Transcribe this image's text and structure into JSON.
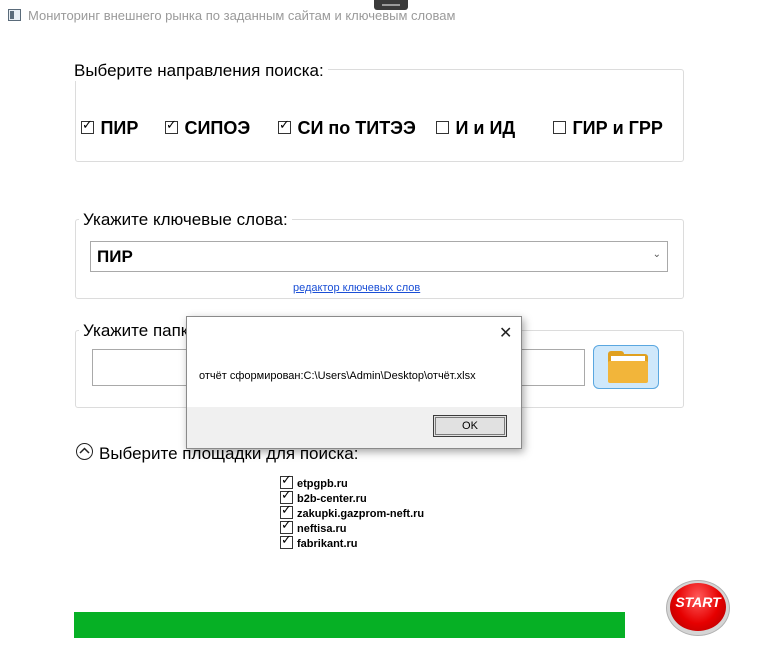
{
  "window": {
    "title": "Мониторинг внешнего рынка по заданным сайтам и ключевым словам"
  },
  "directions": {
    "label": "Выберите направления поиска:",
    "items": [
      {
        "label": "ПИР",
        "checked": true
      },
      {
        "label": "СИПОЭ",
        "checked": true
      },
      {
        "label": "СИ по ТИТЭЭ",
        "checked": true
      },
      {
        "label": "И и ИД",
        "checked": false
      },
      {
        "label": "ГИР и ГРР",
        "checked": false
      }
    ]
  },
  "keywords": {
    "label": "Укажите ключевые слова:",
    "selected": "ПИР",
    "editor_link": "редактор ключевых слов"
  },
  "path": {
    "label": "Укажите папку",
    "value": ""
  },
  "sites": {
    "label": "Выберите площадки для поиска:",
    "items": [
      {
        "label": "etpgpb.ru",
        "checked": true
      },
      {
        "label": "b2b-center.ru",
        "checked": true
      },
      {
        "label": "zakupki.gazprom-neft.ru",
        "checked": true
      },
      {
        "label": "neftisa.ru",
        "checked": true
      },
      {
        "label": "fabrikant.ru",
        "checked": true
      }
    ]
  },
  "progress": {
    "value": 1.0,
    "color": "#06b025"
  },
  "start_button": {
    "label": "START"
  },
  "dialog": {
    "message": "отчёт сформирован:C:\\Users\\Admin\\Desktop\\отчёт.xlsx",
    "ok_label": "OK",
    "close_symbol": "✕"
  },
  "icons": {
    "app": "app-window-icon",
    "folder": "folder-icon",
    "expander": "chevron-up-circle-icon",
    "combo": "chevron-down-icon",
    "close": "close-icon"
  }
}
